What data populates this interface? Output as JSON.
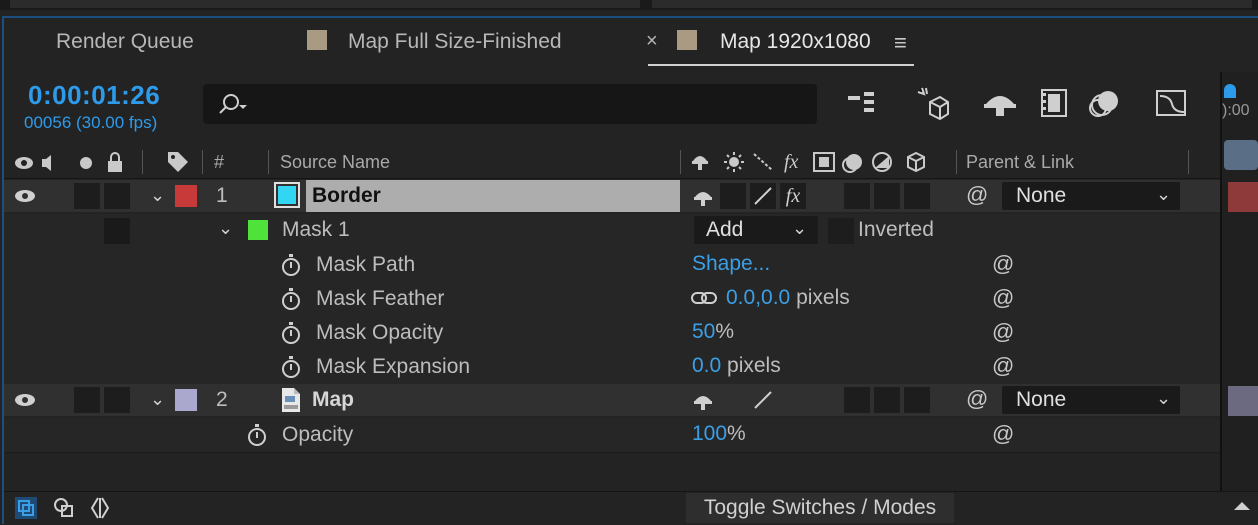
{
  "tabs": [
    {
      "label": "Render Queue"
    },
    {
      "label": "Map Full Size-Finished"
    },
    {
      "label": "Map 1920x1080"
    }
  ],
  "time": {
    "current": "0:00:01:26",
    "frames": "00056 (30.00 fps)"
  },
  "search": {
    "placeholder": ""
  },
  "timeline": {
    "ruler_label": "):00"
  },
  "headers": {
    "hash": "#",
    "source_name": "Source Name",
    "fx": "fx",
    "parent_link": "Parent & Link"
  },
  "layers": [
    {
      "index": "1",
      "name": "Border",
      "label_color": "#c83a3a",
      "swatch_color": "#33d6f2",
      "fx": "fx",
      "parent": "None",
      "mask": {
        "name": "Mask 1",
        "color": "#4ee23a",
        "mode": "Add",
        "inverted_label": "Inverted",
        "properties": [
          {
            "name": "Mask Path",
            "value": "Shape...",
            "unit": ""
          },
          {
            "name": "Mask Feather",
            "value": "0.0,0.0",
            "unit": " pixels"
          },
          {
            "name": "Mask Opacity",
            "value": "50",
            "unit": "%"
          },
          {
            "name": "Mask Expansion",
            "value": "0.0",
            "unit": " pixels"
          }
        ]
      }
    },
    {
      "index": "2",
      "name": "Map",
      "label_color": "#aaa8cc",
      "parent": "None",
      "properties": [
        {
          "name": "Opacity",
          "value": "100",
          "unit": "%"
        }
      ]
    }
  ],
  "footer": {
    "toggle_label": "Toggle Switches / Modes"
  },
  "colors": {
    "accent": "#2e9bea",
    "panel_bg": "#232323",
    "layer_bg": "#303030"
  }
}
